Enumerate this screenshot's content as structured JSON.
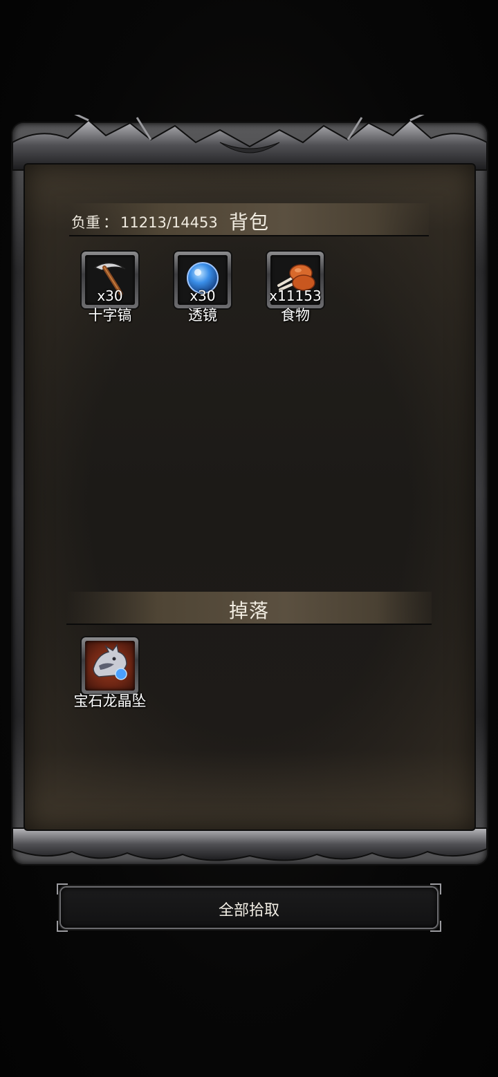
{
  "bag": {
    "title": "背包",
    "weight_label": "负重",
    "weight_separator": "：",
    "weight_value": "11213/14453",
    "items": [
      {
        "name": "十字镐",
        "count": "x30",
        "icon": "pickaxe-icon"
      },
      {
        "name": "透镜",
        "count": "x30",
        "icon": "lens-icon"
      },
      {
        "name": "食物",
        "count": "x11153",
        "icon": "food-icon"
      }
    ]
  },
  "drops": {
    "title": "掉落",
    "items": [
      {
        "name": "宝石龙晶坠",
        "icon": "dragon-pendant-icon",
        "highlight_color": "#9a3a1d"
      }
    ]
  },
  "actions": {
    "pick_all_label": "全部拾取"
  },
  "colors": {
    "background": "#050505",
    "panel": "#1c1a17",
    "section_bar": "#5b5040"
  }
}
